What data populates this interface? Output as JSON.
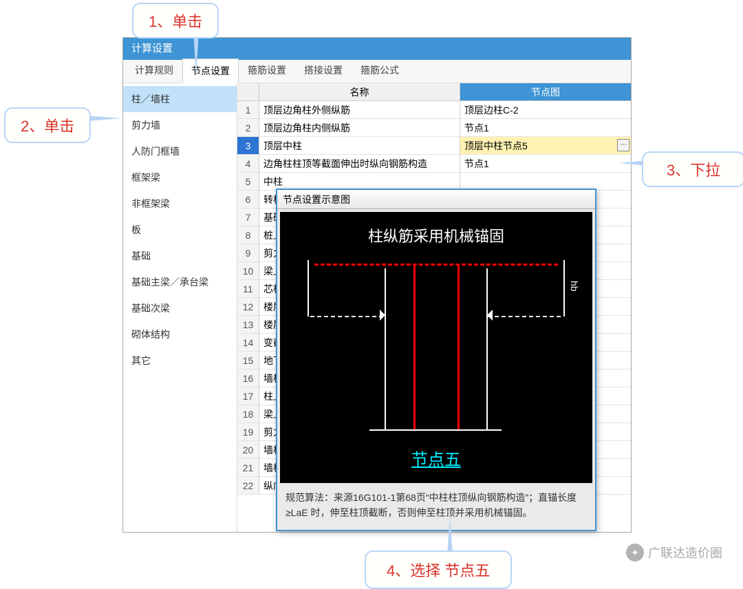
{
  "callouts": {
    "c1": "1、单击",
    "c2": "2、单击",
    "c3": "3、下拉",
    "c4": "4、选择 节点五"
  },
  "window_title": "计算设置",
  "tabs": [
    "计算规则",
    "节点设置",
    "箍筋设置",
    "搭接设置",
    "箍筋公式"
  ],
  "active_tab": "节点设置",
  "sidebar": {
    "items": [
      "柱／墙柱",
      "剪力墙",
      "人防门框墙",
      "框架梁",
      "非框架梁",
      "板",
      "基础",
      "基础主梁／承台梁",
      "基础次梁",
      "砌体结构",
      "其它"
    ]
  },
  "table": {
    "head_name": "名称",
    "head_node": "节点图",
    "rows": [
      {
        "i": 1,
        "name": "顶层边角柱外侧纵筋",
        "node": "顶层边柱C-2"
      },
      {
        "i": 2,
        "name": "顶层边角柱内侧纵筋",
        "node": "节点1"
      },
      {
        "i": 3,
        "name": "顶层中柱",
        "node": "顶层中柱节点5",
        "selected": true
      },
      {
        "i": 4,
        "name": "边角柱柱顶等截面伸出时纵向钢筋构造",
        "node": "节点1"
      },
      {
        "i": 5,
        "name": "中柱"
      },
      {
        "i": 6,
        "name": "转柱"
      },
      {
        "i": 7,
        "name": "基础"
      },
      {
        "i": 8,
        "name": "桩上"
      },
      {
        "i": 9,
        "name": "剪力"
      },
      {
        "i": 10,
        "name": "梁上"
      },
      {
        "i": 11,
        "name": "芯柱"
      },
      {
        "i": 12,
        "name": "楼层"
      },
      {
        "i": 13,
        "name": "楼层"
      },
      {
        "i": 14,
        "name": "变截"
      },
      {
        "i": 15,
        "name": "地下"
      },
      {
        "i": 16,
        "name": "墙柱"
      },
      {
        "i": 17,
        "name": "柱上"
      },
      {
        "i": 18,
        "name": "梁上"
      },
      {
        "i": 19,
        "name": "剪力"
      },
      {
        "i": 20,
        "name": "墙柱"
      },
      {
        "i": 21,
        "name": "墙柱"
      },
      {
        "i": 22,
        "name": "纵向"
      }
    ]
  },
  "popup": {
    "title": "节点设置示意图",
    "heading": "柱纵筋采用机械锚固",
    "node5": "节点五",
    "hb": "hb",
    "desc": "规范算法：来源16G101-1第68页“中柱柱顶纵向钢筋构造”；直锚长度≥LaE 时，伸至柱顶截断，否则伸至柱顶并采用机械锚固。"
  },
  "watermark": "广联达造价圈"
}
